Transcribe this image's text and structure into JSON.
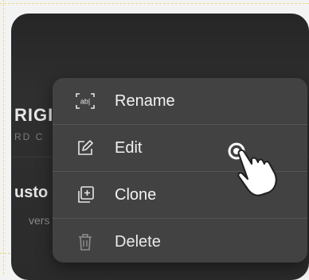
{
  "background_card": {
    "title_fragment": "RIGI",
    "subtitle_fragment": "RD C",
    "name_fragment": "usto",
    "version_fragment": "vers"
  },
  "context_menu": {
    "items": [
      {
        "label": "Rename",
        "icon": "rename-icon"
      },
      {
        "label": "Edit",
        "icon": "edit-icon"
      },
      {
        "label": "Clone",
        "icon": "clone-icon"
      },
      {
        "label": "Delete",
        "icon": "trash-icon"
      }
    ]
  },
  "colors": {
    "menu_background": "#444444",
    "card_background": "#2b2b2b",
    "text": "#f2f2f2"
  }
}
